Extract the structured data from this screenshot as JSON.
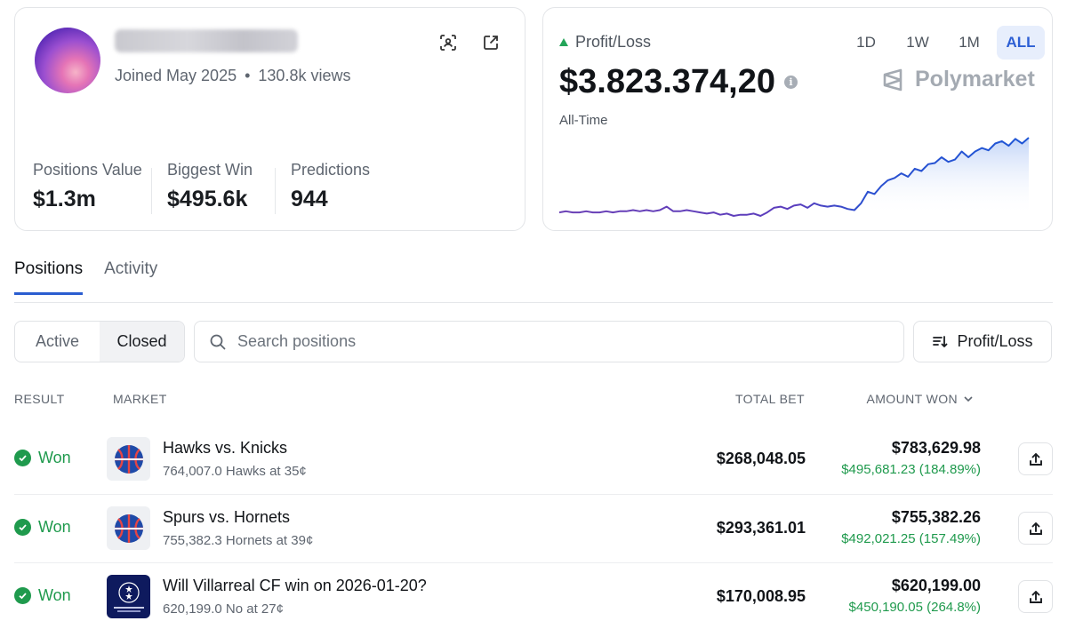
{
  "profile": {
    "joined": "Joined May 2025",
    "views": "130.8k views",
    "stats": [
      {
        "label": "Positions Value",
        "value": "$1.3m"
      },
      {
        "label": "Biggest Win",
        "value": "$495.6k"
      },
      {
        "label": "Predictions",
        "value": "944"
      }
    ]
  },
  "pnl": {
    "label": "Profit/Loss",
    "value": "$3.823.374,20",
    "period_label": "All-Time",
    "brand": "Polymarket",
    "ranges": [
      "1D",
      "1W",
      "1M",
      "ALL"
    ],
    "active_range": "ALL",
    "colors": {
      "up": "#23a559",
      "line_start": "#6a3fb5",
      "line_end": "#1f56d6"
    }
  },
  "tabs": [
    "Positions",
    "Activity"
  ],
  "filters": {
    "segments": [
      "Active",
      "Closed"
    ],
    "active_segment": "Closed",
    "search_placeholder": "Search positions",
    "sort_label": "Profit/Loss"
  },
  "table": {
    "columns": {
      "result": "RESULT",
      "market": "MARKET",
      "total_bet": "TOTAL BET",
      "amount_won": "AMOUNT WON"
    },
    "rows": [
      {
        "result": "Won",
        "title": "Hawks vs. Knicks",
        "sub": "764,007.0 Hawks at 35¢",
        "total_bet": "$268,048.05",
        "amount_won": "$783,629.98",
        "profit": "$495,681.23 (184.89%)",
        "icon": "basketball-icon"
      },
      {
        "result": "Won",
        "title": "Spurs vs. Hornets",
        "sub": "755,382.3 Hornets at 39¢",
        "total_bet": "$293,361.01",
        "amount_won": "$755,382.26",
        "profit": "$492,021.25 (157.49%)",
        "icon": "basketball-icon"
      },
      {
        "result": "Won",
        "title": "Will Villarreal CF win on 2026-01-20?",
        "sub": "620,199.0 No at 27¢",
        "total_bet": "$170,008.95",
        "amount_won": "$620,199.00",
        "profit": "$450,190.05 (264.8%)",
        "icon": "champions-league-icon"
      }
    ]
  },
  "chart_data": {
    "type": "area",
    "title": "",
    "xlabel": "",
    "ylabel": "",
    "x": [
      0,
      1,
      2,
      3,
      4,
      5,
      6,
      7,
      8,
      9,
      10,
      11,
      12,
      13,
      14,
      15,
      16,
      17,
      18,
      19,
      20,
      21,
      22,
      23,
      24,
      25,
      26,
      27,
      28,
      29,
      30,
      31,
      32,
      33,
      34,
      35,
      36,
      37,
      38,
      39,
      40,
      41,
      42,
      43,
      44,
      45,
      46,
      47,
      48,
      49,
      50,
      51,
      52,
      53,
      54,
      55,
      56,
      57,
      58,
      59,
      60,
      61,
      62,
      63,
      64,
      65,
      66,
      67,
      68,
      69,
      70
    ],
    "series": [
      {
        "values": [
          0.02,
          0.03,
          0.02,
          0.02,
          0.03,
          0.02,
          0.02,
          0.03,
          0.02,
          0.03,
          0.03,
          0.04,
          0.03,
          0.04,
          0.03,
          0.04,
          0.07,
          0.03,
          0.03,
          0.04,
          0.03,
          0.02,
          0.01,
          0.02,
          0.0,
          0.01,
          -0.01,
          0.0,
          0.0,
          0.01,
          -0.01,
          0.02,
          0.06,
          0.07,
          0.05,
          0.08,
          0.09,
          0.06,
          0.1,
          0.08,
          0.07,
          0.08,
          0.07,
          0.05,
          0.04,
          0.1,
          0.2,
          0.18,
          0.25,
          0.3,
          0.32,
          0.36,
          0.33,
          0.4,
          0.38,
          0.44,
          0.45,
          0.5,
          0.46,
          0.48,
          0.55,
          0.5,
          0.55,
          0.58,
          0.56,
          0.62,
          0.64,
          0.6,
          0.66,
          0.62,
          0.67
        ]
      }
    ],
    "grid": false,
    "legend": "none"
  }
}
